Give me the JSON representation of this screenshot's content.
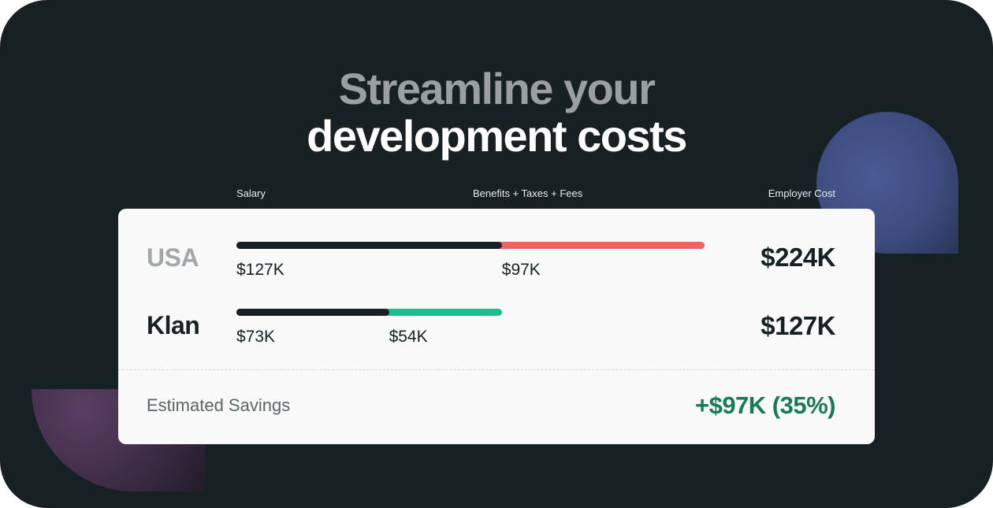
{
  "headline": {
    "line1": "Streamline your",
    "line2": "development costs"
  },
  "columns": {
    "salary": "Salary",
    "benefits": "Benefits + Taxes + Fees",
    "employer_cost": "Employer Cost"
  },
  "rows": [
    {
      "name": "USA",
      "salary": "$127K",
      "extras": "$97K",
      "total": "$224K",
      "salary_k": 127,
      "extras_k": 97,
      "extras_color": "#f06460"
    },
    {
      "name": "Klan",
      "salary": "$73K",
      "extras": "$54K",
      "total": "$127K",
      "salary_k": 73,
      "extras_k": 54,
      "extras_color": "#18c08e"
    }
  ],
  "savings": {
    "label": "Estimated Savings",
    "value": "+$97K (35%)"
  },
  "colors": {
    "background": "#172023",
    "card": "#f8f9f8",
    "salary_bar": "#172023",
    "savings_text": "#187a58"
  }
}
